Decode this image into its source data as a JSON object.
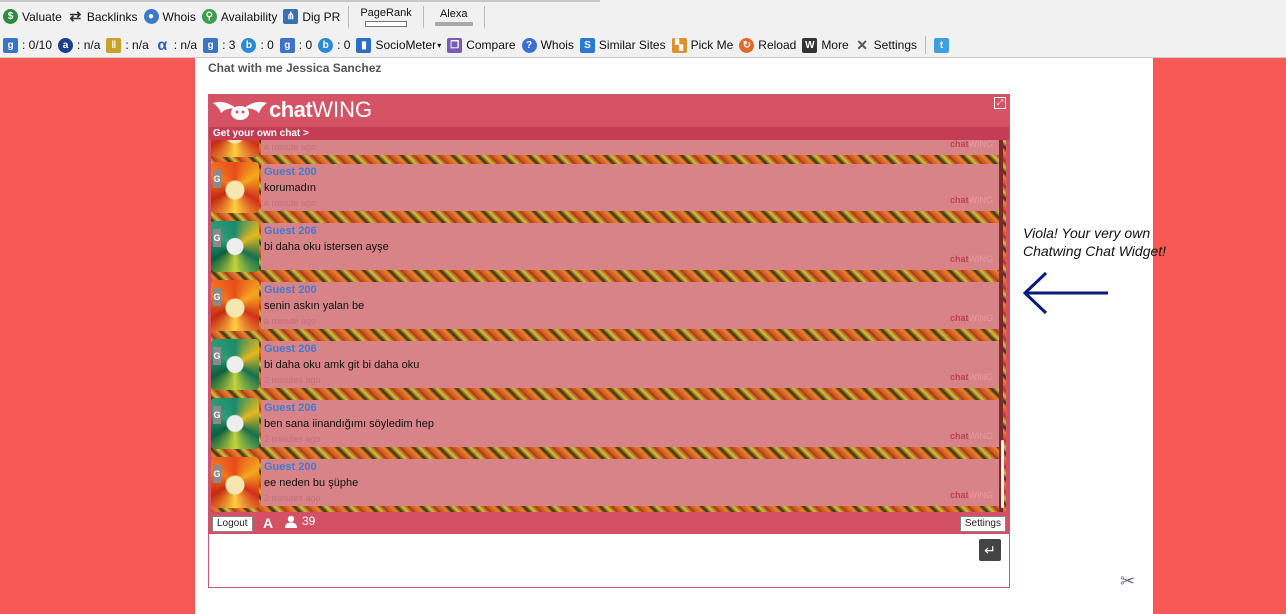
{
  "toolbar1": {
    "items": [
      {
        "label": "Valuate",
        "icon": "dollar-icon",
        "color": "#2d8a3e"
      },
      {
        "label": "Backlinks",
        "icon": "backlinks-arrows-icon",
        "color": "#333333"
      },
      {
        "label": "Whois",
        "icon": "globe-icon",
        "color": "#3a7bc8"
      },
      {
        "label": "Availability",
        "icon": "magnifier-icon",
        "color": "#3aa04a"
      },
      {
        "label": "Dig PR",
        "icon": "sitemap-icon",
        "color": "#3a6fb0"
      }
    ],
    "pagerank_label": "PageRank",
    "alexa_label": "Alexa"
  },
  "toolbar2": {
    "stats": [
      {
        "icon": "google-icon",
        "value": ": 0/10"
      },
      {
        "icon": "alexa-icon",
        "value": ": n/a"
      },
      {
        "icon": "dmoz-icon",
        "value": ": n/a"
      },
      {
        "icon": "alpha-icon",
        "value": ": n/a"
      },
      {
        "icon": "google-index-icon",
        "value": ": 3"
      },
      {
        "icon": "bing-icon",
        "value": ": 0"
      },
      {
        "icon": "google-links-icon",
        "value": ": 0"
      },
      {
        "icon": "bing-links-icon",
        "value": ": 0"
      }
    ],
    "buttons": [
      {
        "label": "SocioMeter",
        "icon": "bar-chart-icon",
        "dropdown": true
      },
      {
        "label": "Compare",
        "icon": "compare-icon"
      },
      {
        "label": "Whois",
        "icon": "question-icon"
      },
      {
        "label": "Similar Sites",
        "icon": "similar-sites-icon"
      },
      {
        "label": "Pick Me",
        "icon": "pickme-icon"
      },
      {
        "label": "Reload",
        "icon": "reload-icon"
      },
      {
        "label": "More",
        "icon": "more-icon"
      },
      {
        "label": "Settings",
        "icon": "settings-tools-icon"
      }
    ],
    "twitter_icon": "twitter-icon"
  },
  "page": {
    "heading": "Chat with me Jessica Sanchez"
  },
  "widget": {
    "logo_chat": "chat",
    "logo_wing": "WING",
    "get_own": "Get your own chat  >",
    "watermark_chat": "chat",
    "watermark_wing": "WING",
    "partial_top_time": "a minute ago",
    "messages": [
      {
        "user": "Guest 200",
        "text": "korumadın",
        "time": "a minute ago",
        "avatar": "flower-orange"
      },
      {
        "user": "Guest 206",
        "text": "bi daha oku istersen ayşe",
        "time": "",
        "avatar": "flower-green"
      },
      {
        "user": "Guest 200",
        "text": "senin askın yalan be",
        "time": "a minute ago",
        "avatar": "flower-orange"
      },
      {
        "user": "Guest 206",
        "text": "bi daha oku amk git bi daha oku",
        "time": "2 minutes ago",
        "avatar": "flower-green"
      },
      {
        "user": "Guest 206",
        "text": "ben sana iinandığımı söyledim hep",
        "time": "2 minutes ago",
        "avatar": "flower-green"
      },
      {
        "user": "Guest 200",
        "text": "ee neden bu şüphe",
        "time": "2 minutes ago",
        "avatar": "flower-orange"
      }
    ],
    "logout_label": "Logout",
    "font_icon_label": "A",
    "user_count": "39",
    "settings_label": "Settings"
  },
  "annotation": {
    "line1": "Viola! Your very own",
    "line2": "Chatwing Chat Widget!"
  }
}
